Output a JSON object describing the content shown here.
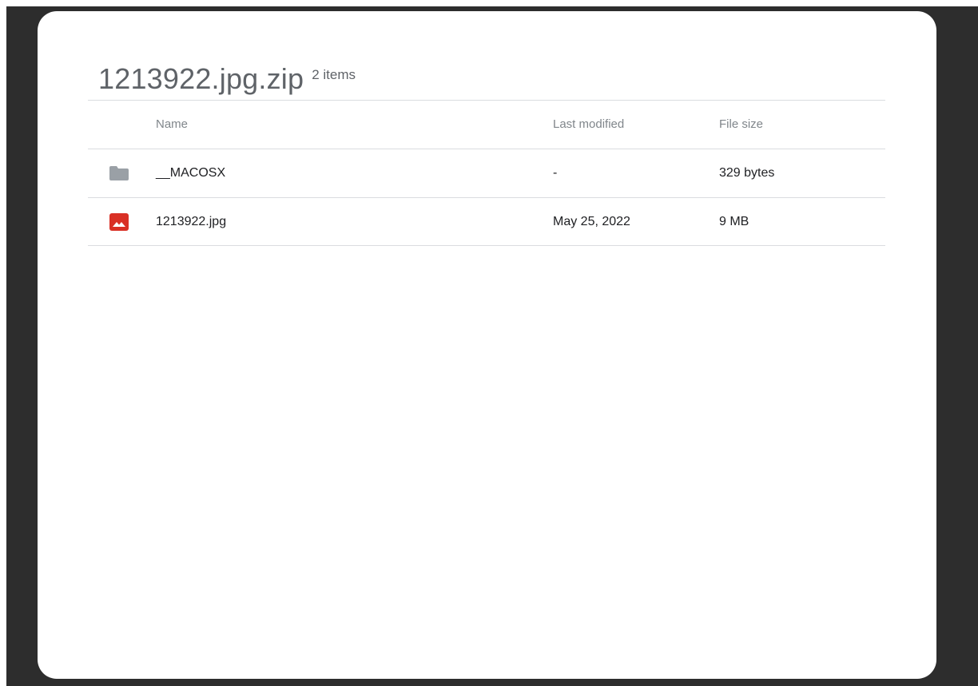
{
  "archive": {
    "title": "1213922.jpg.zip",
    "item_count": "2 items"
  },
  "columns": {
    "name": "Name",
    "last_modified": "Last modified",
    "file_size": "File size"
  },
  "rows": [
    {
      "icon": "folder-icon",
      "name": "__MACOSX",
      "last_modified": "-",
      "file_size": "329 bytes"
    },
    {
      "icon": "image-file-icon",
      "name": "1213922.jpg",
      "last_modified": "May 25, 2022",
      "file_size": "9 MB"
    }
  ],
  "colors": {
    "backdrop": "#2d2d2d",
    "folder_icon": "#9aa0a6",
    "image_icon": "#d93025",
    "divider": "#dadce0"
  }
}
